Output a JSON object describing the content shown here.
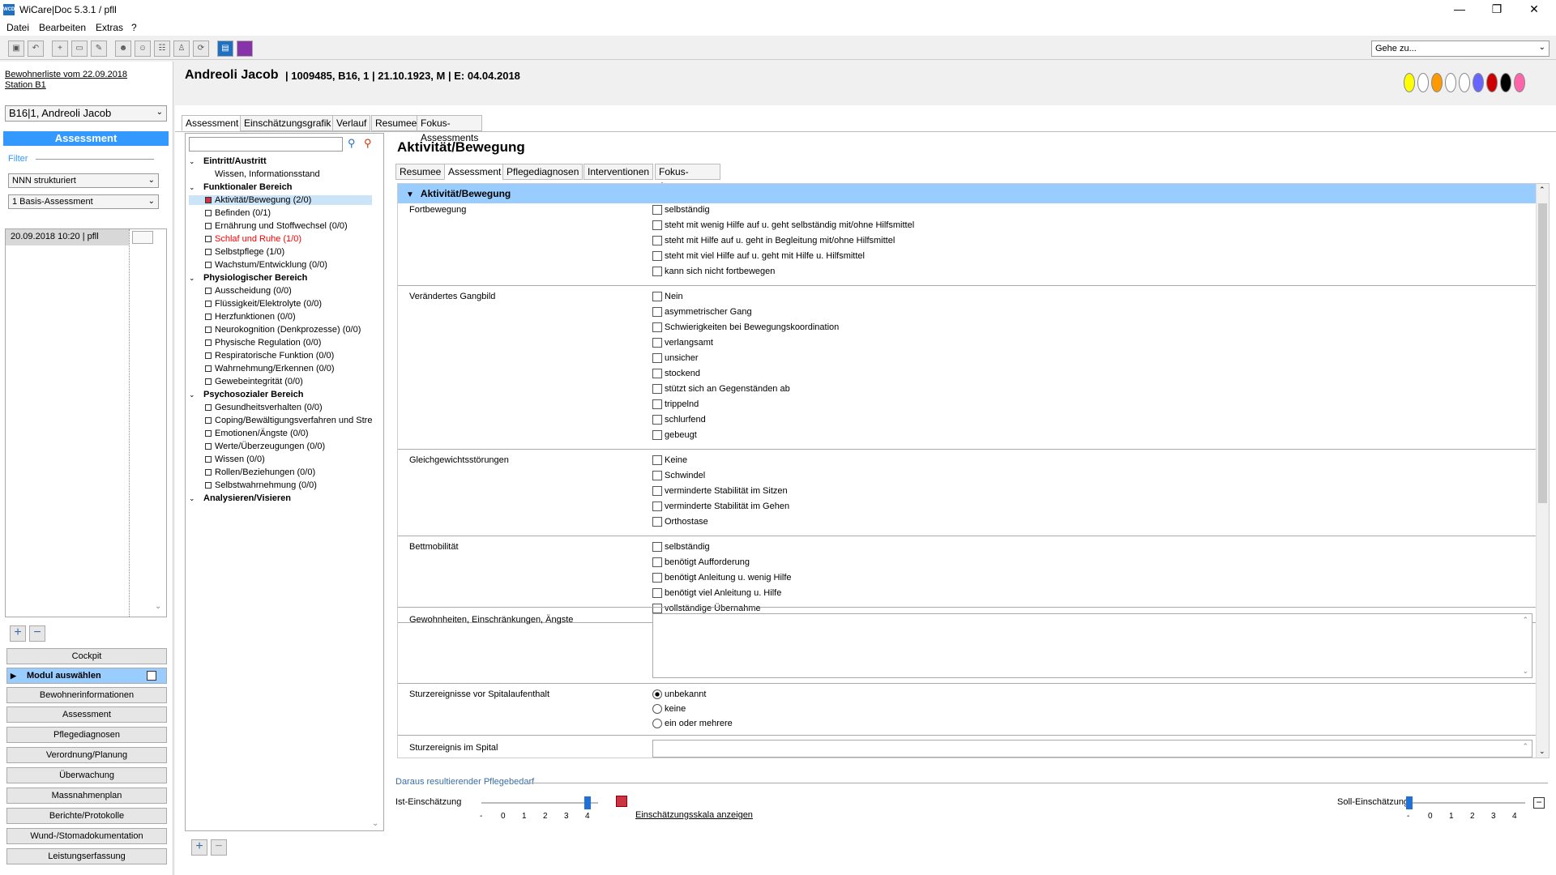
{
  "app": {
    "title": "WiCare|Doc 5.3.1  / pfll",
    "min": "—",
    "max": "❐",
    "close": "✕"
  },
  "menu": [
    "Datei",
    "Bearbeiten",
    "Extras",
    "?"
  ],
  "goto": {
    "placeholder": "Gehe zu..."
  },
  "left": {
    "list_link": "Bewohnerliste vom 22.09.2018",
    "station": "Station B1",
    "patient_select": "B16|1, Andreoli Jacob",
    "assessment_header": "Assessment",
    "filter_label": "Filter",
    "filter1": "NNN strukturiert",
    "filter2": "1 Basis-Assessment",
    "entry": "20.09.2018 10:20 | pfll",
    "add": "+",
    "remove": "−",
    "nav": [
      "Cockpit",
      "Modul auswählen",
      "Bewohnerinformationen",
      "Assessment",
      "Pflegediagnosen",
      "Verordnung/Planung",
      "Überwachung",
      "Massnahmenplan",
      "Berichte/Protokolle",
      "Wund-/Stomadokumentation",
      "Leistungserfassung"
    ]
  },
  "header": {
    "name": "Andreoli Jacob",
    "info": "| 1009485, B16, 1 | 21.10.1923, M | E: 04.04.2018"
  },
  "tabs": [
    "Assessment",
    "Einschätzungsgrafik",
    "Verlauf",
    "Resumee",
    "Fokus-Assessments"
  ],
  "tree": [
    {
      "t": "Eintritt/Austritt",
      "lvl": 0
    },
    {
      "t": "Wissen, Informationsstand",
      "lvl": 1
    },
    {
      "t": "Funktionaler Bereich",
      "lvl": 0
    },
    {
      "t": "Aktivität/Bewegung (2/0)",
      "lvl": 1,
      "sel": true
    },
    {
      "t": "Befinden (0/1)",
      "lvl": 1
    },
    {
      "t": "Ernährung und Stoffwechsel (0/0)",
      "lvl": 1
    },
    {
      "t": "Schlaf und Ruhe (1/0)",
      "lvl": 1,
      "red": true
    },
    {
      "t": "Selbstpflege (1/0)",
      "lvl": 1
    },
    {
      "t": "Wachstum/Entwicklung (0/0)",
      "lvl": 1
    },
    {
      "t": "Physiologischer Bereich",
      "lvl": 0
    },
    {
      "t": "Ausscheidung (0/0)",
      "lvl": 1
    },
    {
      "t": "Flüssigkeit/Elektrolyte (0/0)",
      "lvl": 1
    },
    {
      "t": "Herzfunktionen (0/0)",
      "lvl": 1
    },
    {
      "t": "Neurokognition (Denkprozesse) (0/0)",
      "lvl": 1
    },
    {
      "t": "Physische Regulation (0/0)",
      "lvl": 1
    },
    {
      "t": "Respiratorische Funktion (0/0)",
      "lvl": 1
    },
    {
      "t": "Wahrnehmung/Erkennen (0/0)",
      "lvl": 1
    },
    {
      "t": "Gewebeintegrität (0/0)",
      "lvl": 1
    },
    {
      "t": "Psychosozialer Bereich",
      "lvl": 0
    },
    {
      "t": "Gesundheitsverhalten (0/0)",
      "lvl": 1
    },
    {
      "t": "Coping/Bewältigungsverfahren und Stre",
      "lvl": 1
    },
    {
      "t": "Emotionen/Ängste (0/0)",
      "lvl": 1
    },
    {
      "t": "Werte/Überzeugungen (0/0)",
      "lvl": 1
    },
    {
      "t": "Wissen (0/0)",
      "lvl": 1
    },
    {
      "t": "Rollen/Beziehungen (0/0)",
      "lvl": 1
    },
    {
      "t": "Selbstwahrnehmung (0/0)",
      "lvl": 1
    },
    {
      "t": "Analysieren/Visieren",
      "lvl": 0
    }
  ],
  "main": {
    "title": "Aktivität/Bewegung",
    "subtabs": [
      "Resumee",
      "Assessment",
      "Pflegediagnosen",
      "Interventionen",
      "Fokus-Assessments"
    ],
    "section": "Aktivität/Bewegung",
    "groups": [
      {
        "label": "Fortbewegung",
        "options": [
          "selbständig",
          "steht mit wenig Hilfe auf u. geht selbständig mit/ohne Hilfsmittel",
          "steht mit Hilfe auf u. geht in Begleitung mit/ohne Hilfsmittel",
          "steht mit viel Hilfe auf u. geht mit Hilfe u. Hilfsmittel",
          "kann sich nicht fortbewegen"
        ]
      },
      {
        "label": "Verändertes Gangbild",
        "options": [
          "Nein",
          "asymmetrischer Gang",
          "Schwierigkeiten bei Bewegungskoordination",
          "verlangsamt",
          "unsicher",
          "stockend",
          "stützt sich an Gegenständen ab",
          "trippelnd",
          "schlurfend",
          "gebeugt"
        ]
      },
      {
        "label": "Gleichgewichtsstörungen",
        "options": [
          "Keine",
          "Schwindel",
          "verminderte Stabilität im Sitzen",
          "verminderte Stabilität im Gehen",
          "Orthostase"
        ]
      },
      {
        "label": "Bettmobilität",
        "options": [
          "selbständig",
          "benötigt Aufforderung",
          "benötigt Anleitung u. wenig Hilfe",
          "benötigt viel Anleitung u. Hilfe",
          "vollständige Übernahme"
        ]
      }
    ],
    "habits_label": "Gewohnheiten, Einschränkungen, Ängste",
    "falls_label": "Sturzereignisse vor Spitalaufenthalt",
    "falls_options": [
      "unbekannt",
      "keine",
      "ein oder mehrere"
    ],
    "falls_selected": "unbekannt",
    "hospital_label": "Sturzereignis im Spital"
  },
  "bottom": {
    "need_label": "Daraus resultierender Pflegebedarf",
    "ist_label": "Ist-Einschätzung",
    "soll_label": "Soll-Einschätzung",
    "scale_ticks": [
      "-",
      "0",
      "1",
      "2",
      "3",
      "4"
    ],
    "ist_value": "4",
    "soll_value": "-",
    "scale_link": "Einschätzungsskala anzeigen"
  },
  "colors": {
    "accent": "#3399ff",
    "section": "#99ccff",
    "red": "#ff0000",
    "dots": [
      "#ffff00",
      "#ffffff",
      "#ff9900",
      "#ffffff",
      "#ffffff",
      "#6666ff",
      "#cc0000",
      "#000000",
      "#ff66aa"
    ]
  }
}
